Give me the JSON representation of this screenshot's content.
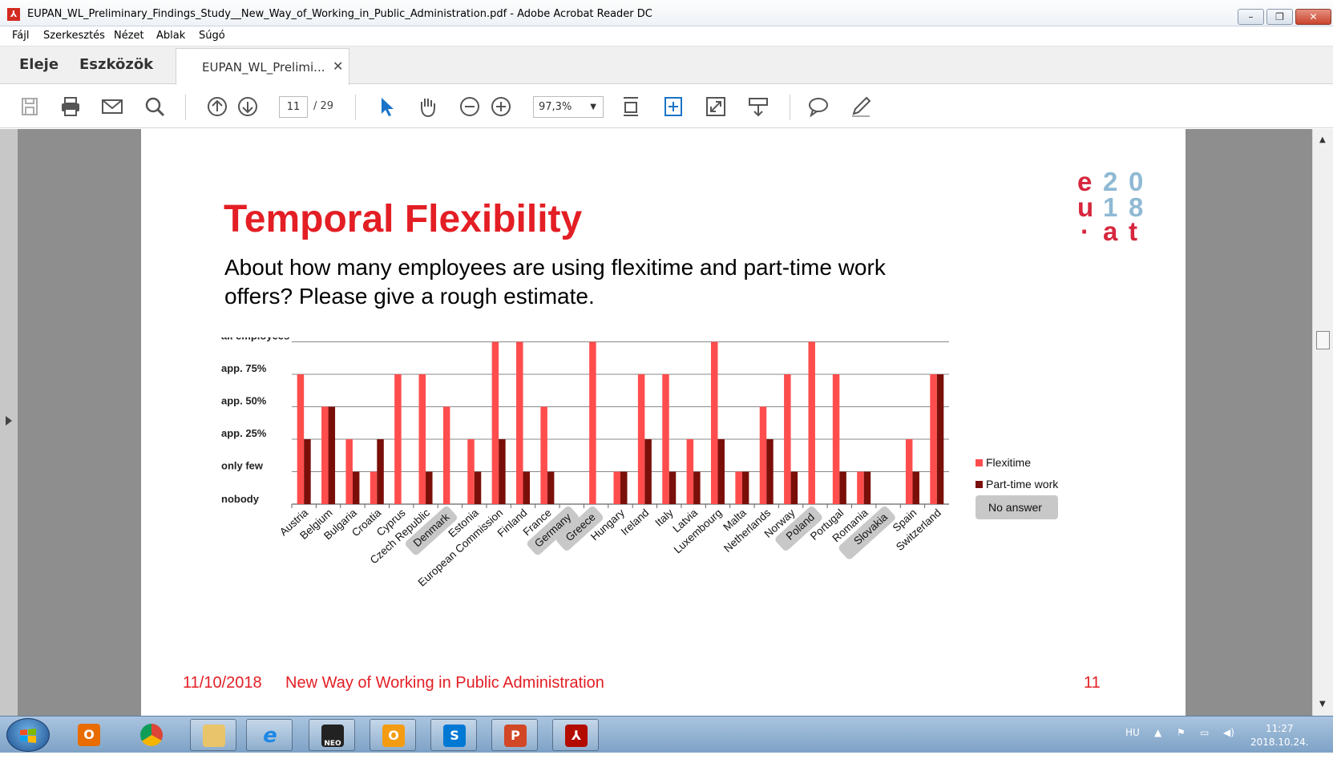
{
  "window": {
    "title": "EUPAN_WL_Preliminary_Findings_Study__New_Way_of_Working_in_Public_Administration.pdf - Adobe Acrobat Reader DC",
    "minimize": "–",
    "maximize": "❐",
    "close": "✕"
  },
  "menu": [
    "Fájl",
    "Szerkesztés",
    "Nézet",
    "Ablak",
    "Súgó"
  ],
  "tabs": {
    "home": "Eleje",
    "tools": "Eszközök",
    "document": "EUPAN_WL_Prelimi...",
    "close": "✕"
  },
  "toolbar": {
    "page_current": "11",
    "page_total": "/ 29",
    "zoom": "97,3%",
    "zoom_dropdown": "▼"
  },
  "icons": {
    "save": "save-icon",
    "print": "print-icon",
    "email": "email-icon",
    "search": "search-icon",
    "page_up": "arrow-up-circle-icon",
    "page_down": "arrow-down-circle-icon",
    "select": "pointer-icon",
    "hand": "hand-icon",
    "zoom_out": "zoom-out-icon",
    "zoom_in": "zoom-in-icon",
    "fit_page": "fit-page-icon",
    "fit_width": "fit-width-icon",
    "fullscreen": "fullscreen-icon",
    "scroll_mode": "scroll-mode-icon",
    "comment": "comment-icon",
    "sign": "sign-icon"
  },
  "slide": {
    "logo": {
      "col1": [
        "e",
        "u",
        "·"
      ],
      "col2": [
        "2",
        "1",
        "a"
      ],
      "col3": [
        "0",
        "8",
        "t"
      ],
      "red": "#d7263d",
      "blue": "#8fb9d4"
    },
    "title": "Temporal Flexibility",
    "question": "About how many employees are using flexitime and part-time work offers? Please give a rough estimate.",
    "footer_date": "11/10/2018",
    "footer_text": "New Way of Working in Public Administration",
    "page_number": "11"
  },
  "chart_data": {
    "type": "bar",
    "y_levels": [
      "nobody",
      "only few",
      "app. 25%",
      "app. 50%",
      "app. 75%",
      "all employees"
    ],
    "categories": [
      "Austria",
      "Belgium",
      "Bulgaria",
      "Croatia",
      "Cyprus",
      "Czech Republic",
      "Denmark",
      "Estonia",
      "European Commission",
      "Finland",
      "France",
      "Germany",
      "Greece",
      "Hungary",
      "Ireland",
      "Italy",
      "Latvia",
      "Luxembourg",
      "Malta",
      "Netherlands",
      "Norway",
      "Poland",
      "Portugal",
      "Romania",
      "Slovakia",
      "Spain",
      "Switzerland"
    ],
    "no_answer": [
      "Denmark",
      "Germany",
      "Greece",
      "Poland",
      "Slovakia"
    ],
    "series": [
      {
        "name": "Flexitime",
        "color": "#ff4d4d",
        "values": [
          4,
          3,
          2,
          1,
          4,
          4,
          3,
          2,
          5,
          5,
          3,
          0,
          5,
          1,
          4,
          4,
          2,
          5,
          1,
          3,
          4,
          5,
          4,
          1,
          0,
          2,
          4
        ]
      },
      {
        "name": "Part-time work",
        "color": "#7a0f0a",
        "values": [
          2,
          3,
          1,
          2,
          0,
          1,
          0,
          1,
          2,
          1,
          1,
          0,
          0,
          1,
          2,
          1,
          1,
          2,
          1,
          2,
          1,
          0,
          1,
          1,
          0,
          1,
          4
        ]
      }
    ],
    "legend": {
      "placement": "right",
      "no_answer_label": "No answer"
    },
    "grid": true
  },
  "taskbar": {
    "apps": [
      "outlook-icon",
      "chrome-icon",
      "explorer-icon",
      "ie-icon",
      "neo-icon",
      "outlook-calendar-icon",
      "skype-business-icon",
      "powerpoint-icon",
      "acrobat-icon"
    ],
    "neo_label": "NEO",
    "lang": "HU",
    "tray_up": "▲",
    "time": "11:27",
    "date": "2018.10.24."
  }
}
